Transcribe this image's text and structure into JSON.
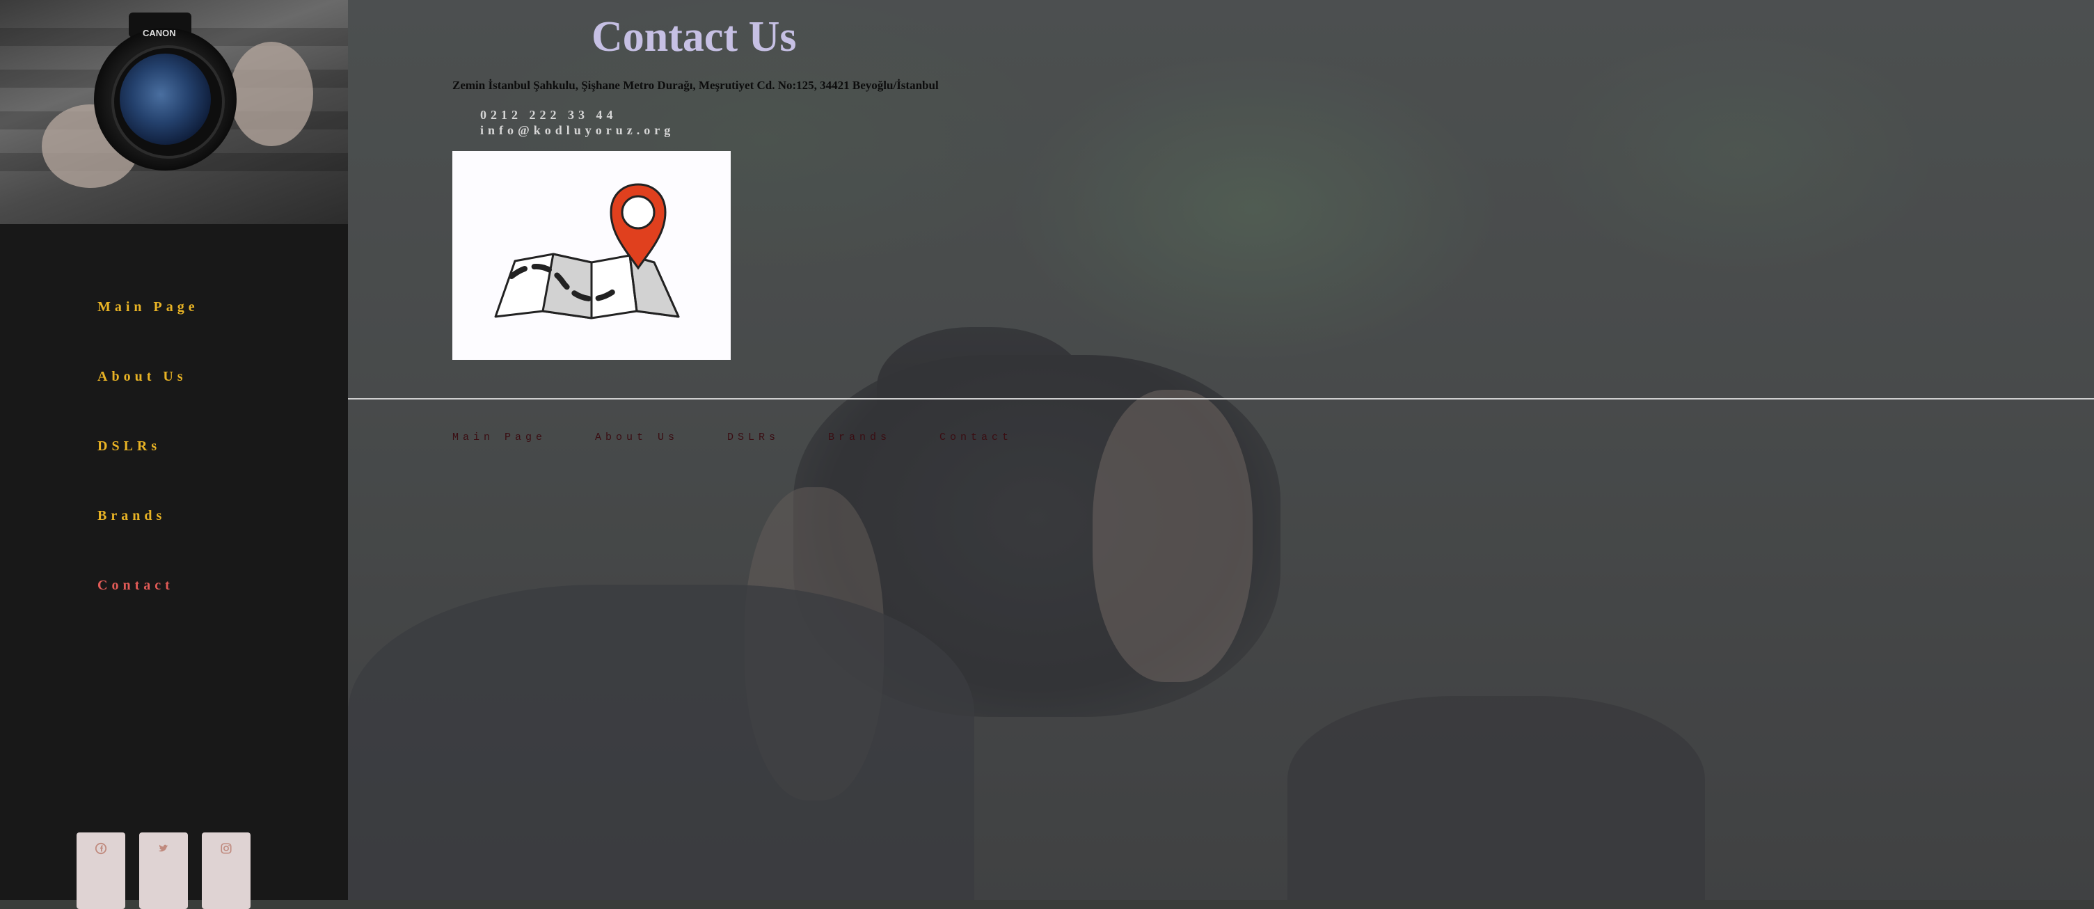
{
  "sidebar": {
    "photo_label": "CANON",
    "nav": [
      {
        "label": "Main Page",
        "active": false
      },
      {
        "label": "About Us",
        "active": false
      },
      {
        "label": "DSLRs",
        "active": false
      },
      {
        "label": "Brands",
        "active": false
      },
      {
        "label": "Contact",
        "active": true
      }
    ],
    "social": [
      {
        "icon": "facebook-icon"
      },
      {
        "icon": "twitter-icon"
      },
      {
        "icon": "instagram-icon"
      }
    ]
  },
  "main": {
    "title": "Contact Us",
    "address": "Zemin İstanbul Şahkulu, Şişhane Metro Durağı, Meşrutiyet Cd. No:125, 34421 Beyoğlu/İstanbul",
    "phone": "0212 222 33 44",
    "email": "info@kodluyoruz.org",
    "map_icon": "map-pin-icon",
    "footer_nav": [
      {
        "label": "Main Page"
      },
      {
        "label": "About Us"
      },
      {
        "label": "DSLRs"
      },
      {
        "label": "Brands"
      },
      {
        "label": "Contact"
      }
    ]
  },
  "colors": {
    "nav": "#e8b325",
    "nav_active": "#e25b57",
    "title": "#c6c0e4",
    "pin": "#e0401e",
    "footer_link": "#3a0d12"
  }
}
